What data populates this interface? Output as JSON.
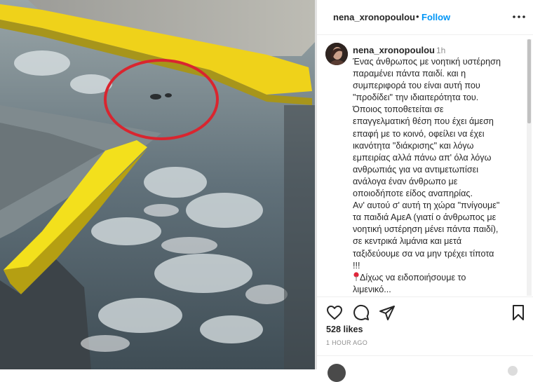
{
  "post": {
    "username": "nena_xronopoulou",
    "dot": "•",
    "follow_label": "Follow",
    "more_icon": "more-horizontal-icon"
  },
  "caption": {
    "username": "nena_xronopoulou",
    "time": "1h",
    "lines": [
      "Ένας άνθρωπος με νοητική υστέρηση",
      "παραμένει πάντα παιδί. και η",
      "συμπεριφορά του είναι αυτή που",
      "\"προδίδει\" την ιδιαιτερότητα του.",
      "Όποιος τοποθετείται σε",
      "επαγγελματική θέση που έχει άμεση",
      "επαφή με το κοινό, οφείλει να έχει",
      "ικανότητα \"διάκρισης\" και λόγω",
      "εμπειρίας αλλά πάνω απ' όλα λόγω",
      "ανθρωπιάς για να αντιμετωπίσει",
      "ανάλογα έναν άνθρωπο με",
      "οποιοδήποτε είδος αναπηρίας.",
      "Αν' αυτού σ' αυτή τη χώρα \"πνίγουμε\"",
      "τα παιδιά ΑμεΑ (γιατί ο άνθρωπος με",
      "νοητική υστέρηση μένει πάντα παιδί),",
      "σε κεντρικά λιμάνια και μετά",
      "ταξιδεύουμε σα να μην τρέχει τίποτα",
      "!!!"
    ],
    "pin_icon": "red-pin-icon",
    "last_line": "Δίχως να ειδοποιήσουμε το",
    "last_line_2": "λιμενικό..."
  },
  "actions": {
    "icons": [
      "heart-icon",
      "comment-icon",
      "share-icon",
      "bookmark-icon"
    ]
  },
  "likes_label": "528 likes",
  "time_ago": "1 HOUR AGO",
  "colors": {
    "follow": "#0095f6",
    "circle": "#d9252f",
    "ramp_yellow": "#f3e01c",
    "muted": "#8e8e8e"
  }
}
